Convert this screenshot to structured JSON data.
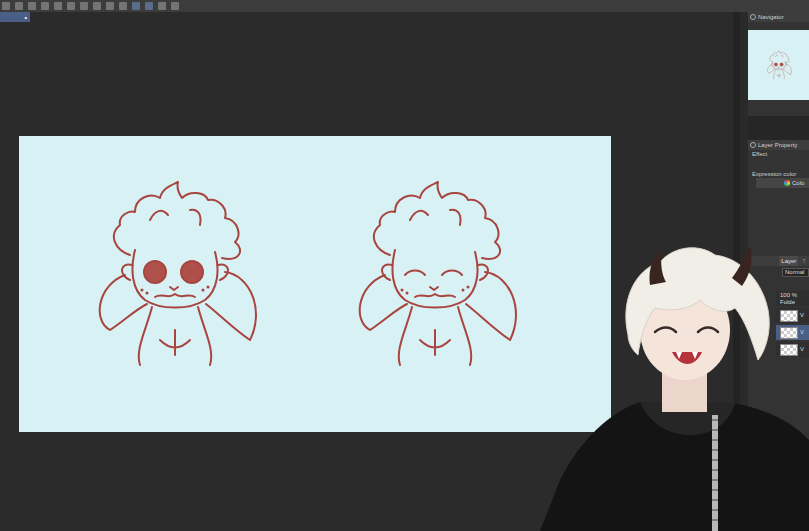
{
  "document_tab": {
    "mark": "•",
    "selected": true
  },
  "canvas": {
    "sketches": [
      {
        "kind": "open"
      },
      {
        "kind": "closed"
      }
    ]
  },
  "navigator": {
    "title": "Navigator"
  },
  "layer_property": {
    "title": "Layer Property",
    "effect_label": "Effect",
    "expression_color_label": "Expression color",
    "color_button": "Colo"
  },
  "layer_panel": {
    "tabs": [
      {
        "label": "Layer",
        "selected": true
      },
      {
        "label": "T",
        "selected": false
      }
    ],
    "blend_mode": "Normal",
    "layers": [
      {
        "name": "100 %",
        "sub": "Folde",
        "selected": false
      },
      {
        "name": "V",
        "sub": "",
        "selected": false
      },
      {
        "name": "V",
        "sub": "",
        "selected": true
      },
      {
        "name": "V",
        "sub": "",
        "selected": false
      }
    ]
  }
}
